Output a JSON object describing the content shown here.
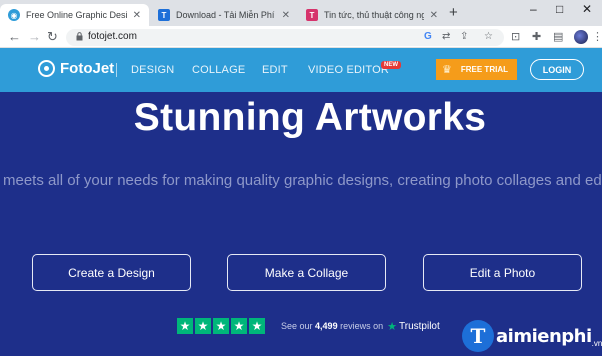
{
  "browser": {
    "tabs": [
      {
        "title": "Free Online Graphic Designer &",
        "favicon": "fotojet-icon",
        "color": "#2f9cd8",
        "active": true
      },
      {
        "title": "Download - Tải Miễn Phí VN -",
        "favicon": "taimienphi-icon",
        "color": "#1d6fd8",
        "active": false
      },
      {
        "title": "Tin tức, thủ thuật công nghệ mo",
        "favicon": "taimienphi-news-icon",
        "color": "#d6336c",
        "active": false
      }
    ],
    "new_tab": "+",
    "url": "fotojet.com",
    "window_controls": {
      "minimize": "–",
      "maximize": "□",
      "close": "✕"
    }
  },
  "header": {
    "logo_text": "FotoJet",
    "nav": [
      "DESIGN",
      "COLLAGE",
      "EDIT",
      "VIDEO EDITOR"
    ],
    "new_badge": "NEW",
    "trial_label": "FREE TRIAL",
    "login_label": "LOGIN",
    "accent": "#2f9cd8",
    "trial_color": "#f59c1a"
  },
  "hero": {
    "headline": "Stunning Artworks",
    "subline": "meets all of your needs for making quality graphic designs, creating photo collages and editi",
    "buttons": [
      "Create a Design",
      "Make a Collage",
      "Edit a Photo"
    ],
    "rating": {
      "prefix": "See our",
      "count": "4,499",
      "suffix": "reviews on",
      "brand": "Trustpilot",
      "stars": 5
    },
    "background": "#1e2f8a"
  },
  "watermark": {
    "letter": "T",
    "text": "aimienphi",
    "suffix": ".vn"
  }
}
